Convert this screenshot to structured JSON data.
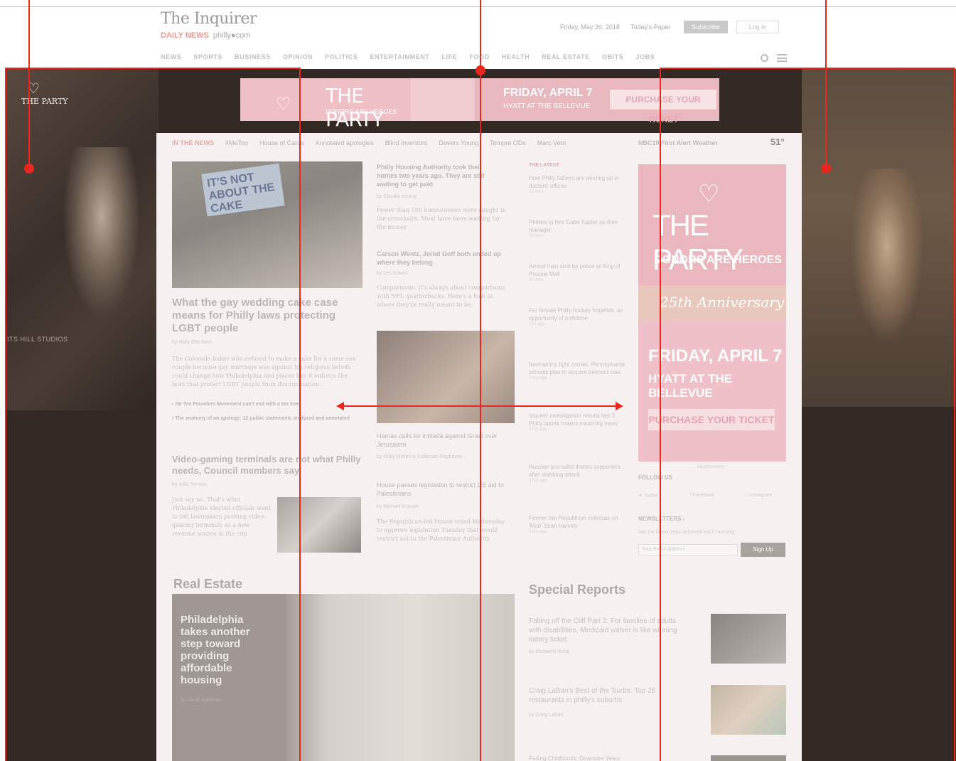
{
  "header": {
    "logo": "The Inquirer",
    "sublogo_brand": "DAILY NEWS",
    "sublogo_site": "philly●com",
    "date": "Friday, May 26, 2018",
    "todays_paper": "Today's Paper",
    "subscribe": "Subscribe",
    "login": "Log in",
    "nav": [
      "NEWS",
      "SPORTS",
      "BUSINESS",
      "OPINION",
      "POLITICS",
      "ENTERTAINMENT",
      "LIFE",
      "FOOD",
      "HEALTH",
      "REAL ESTATE",
      "OBITS",
      "JOBS"
    ]
  },
  "takeover": {
    "party_logo": "THE PARTY",
    "studios": "ITS HILL STUDIOS"
  },
  "top_ad": {
    "title": "THE PARTY",
    "subtitle": "DONORS ARE HEROES",
    "date": "FRIDAY, APRIL 7",
    "venue": "HYATT AT THE BELLEVUE",
    "cta": "PURCHASE YOUR TICKET"
  },
  "news_bar": {
    "label": "IN THE NEWS",
    "items": [
      "#MeToo",
      "House of Cards",
      "Annotated apologies",
      "Blind Inventors",
      "Devers Young",
      "Tempre ODs",
      "Marc Vetri"
    ],
    "weather": "NBC10 First Alert Weather",
    "temp": "51°"
  },
  "lead": {
    "sign": "IT'S NOT ABOUT THE CAKE",
    "headline": "What the gay wedding cake case means for Philly laws protecting LGBT people",
    "byline": "by Holly Otterbein",
    "body": "The Colorado baker who refused to make a cake for a same-sex couple because gay marriage was against his religious beliefs could change how Philadelphia and places like it enforce the laws that protect LGBT people from discrimination.",
    "bullet1": "No Tea Founders Movement can't end with a tea tree",
    "bullet2": "The anatomy of an apology: 12 public statements analyzed and annotated"
  },
  "video": {
    "headline": "Video-gaming terminals are not what Philly needs, Council members say",
    "byline": "by Julia Terruso",
    "body": "Just say no. That's what Philadelphia elected officials want to tell lawmakers pushing video-gaming terminals as a new revenue source in the city."
  },
  "middle": {
    "s1_headline": "Philly Housing Authority took their homes two years ago. They are still waiting to get paid",
    "s1_byline": "by Claudia Irizarry",
    "s1_body": "Fewer than 100 homeowners were caught in the crosshairs. Most have been waiting for the money",
    "s2_headline": "Carson Wentz, Jerod Goff both ended up where they belong",
    "s2_byline": "by Les Bowen",
    "s2_body": "Comparisons. It's always about comparisons with NFL quarterbacks. Here's a look at where they're really meant to be.",
    "s3_headline": "Hamas calls for intifada against Israel over Jerusalem",
    "s3_byline": "by Ruby Mellen & Sudarsan Raghavan",
    "s4_headline": "House passes legislation to restrict US aid to Palestinians",
    "s4_byline": "by Michael Kranish",
    "s4_body": "The Republican-led House voted Wednesday to approve legislation Tuesday that would restrict aid to the Palestinian Authority."
  },
  "latest": {
    "label": "THE LATEST",
    "items": [
      {
        "t": "How Philly fathers are winning up in doctors' offices",
        "time": "10 mins"
      },
      {
        "t": "Phillies to hire Gabe Kapler as their manager",
        "time": "20 mins"
      },
      {
        "t": "Armed man shot by police at King of Prussia Mall",
        "time": "30 mins"
      },
      {
        "t": "For female Philly hockey hopefuls, an opportunity of a lifetime",
        "time": "1 hr ago"
      },
      {
        "t": "Neshaminy fight comes: Pennsylvania schools plan to acquire beloved cars",
        "time": "2 hrs ago"
      },
      {
        "t": "Inquirer investigation results last 3 Philly sports towers made big news",
        "time": "3 hrs ago"
      },
      {
        "t": "Russian journalist thanks supporters after stabbing attack",
        "time": "4 hrs ago"
      },
      {
        "t": "Former top Republican criticizes on 'Mob' Sean Hannity",
        "time": "5 hrs ago"
      }
    ]
  },
  "right_ad": {
    "title": "THE PARTY",
    "subtitle": "DONORS ARE HEROES",
    "anniversary": "25th Anniversary",
    "date": "FRIDAY, APRIL 7",
    "venue": "HYATT AT THE BELLEVUE",
    "cta": "PURCHASE YOUR TICKET",
    "label": "Advertisement"
  },
  "follow": {
    "label": "FOLLOW US",
    "twitter": "Twitter",
    "facebook": "Facebook",
    "instagram": "Instagram"
  },
  "newsletter": {
    "label": "NEWSLETTERS ›",
    "text": "Get the latest news delivered each morning",
    "placeholder": "Your Email Address",
    "button": "Sign Up"
  },
  "real_estate": {
    "title": "Real Estate",
    "overlay": "Philadelphia takes another step toward providing affordable housing",
    "byline": "by Jacob Adelman"
  },
  "special": {
    "title": "Special Reports",
    "s1": "Falling off the Cliff Part 2: For families of adults with disabilities, Medicaid waiver is like winning lottery ticket",
    "s1_byline": "by Michaelle Bond",
    "s2": "Craig LaBan's Best of the 'burbs: Top 25 restaurants in philly's suburbs",
    "s2_byline": "by Craig LaBan",
    "s3": "Fading Childhoods: Downsize Years"
  },
  "colors": {
    "annotation_red": "#e8281e",
    "takeover_bg": "#332925",
    "ad_pink": "#eab7bf"
  }
}
